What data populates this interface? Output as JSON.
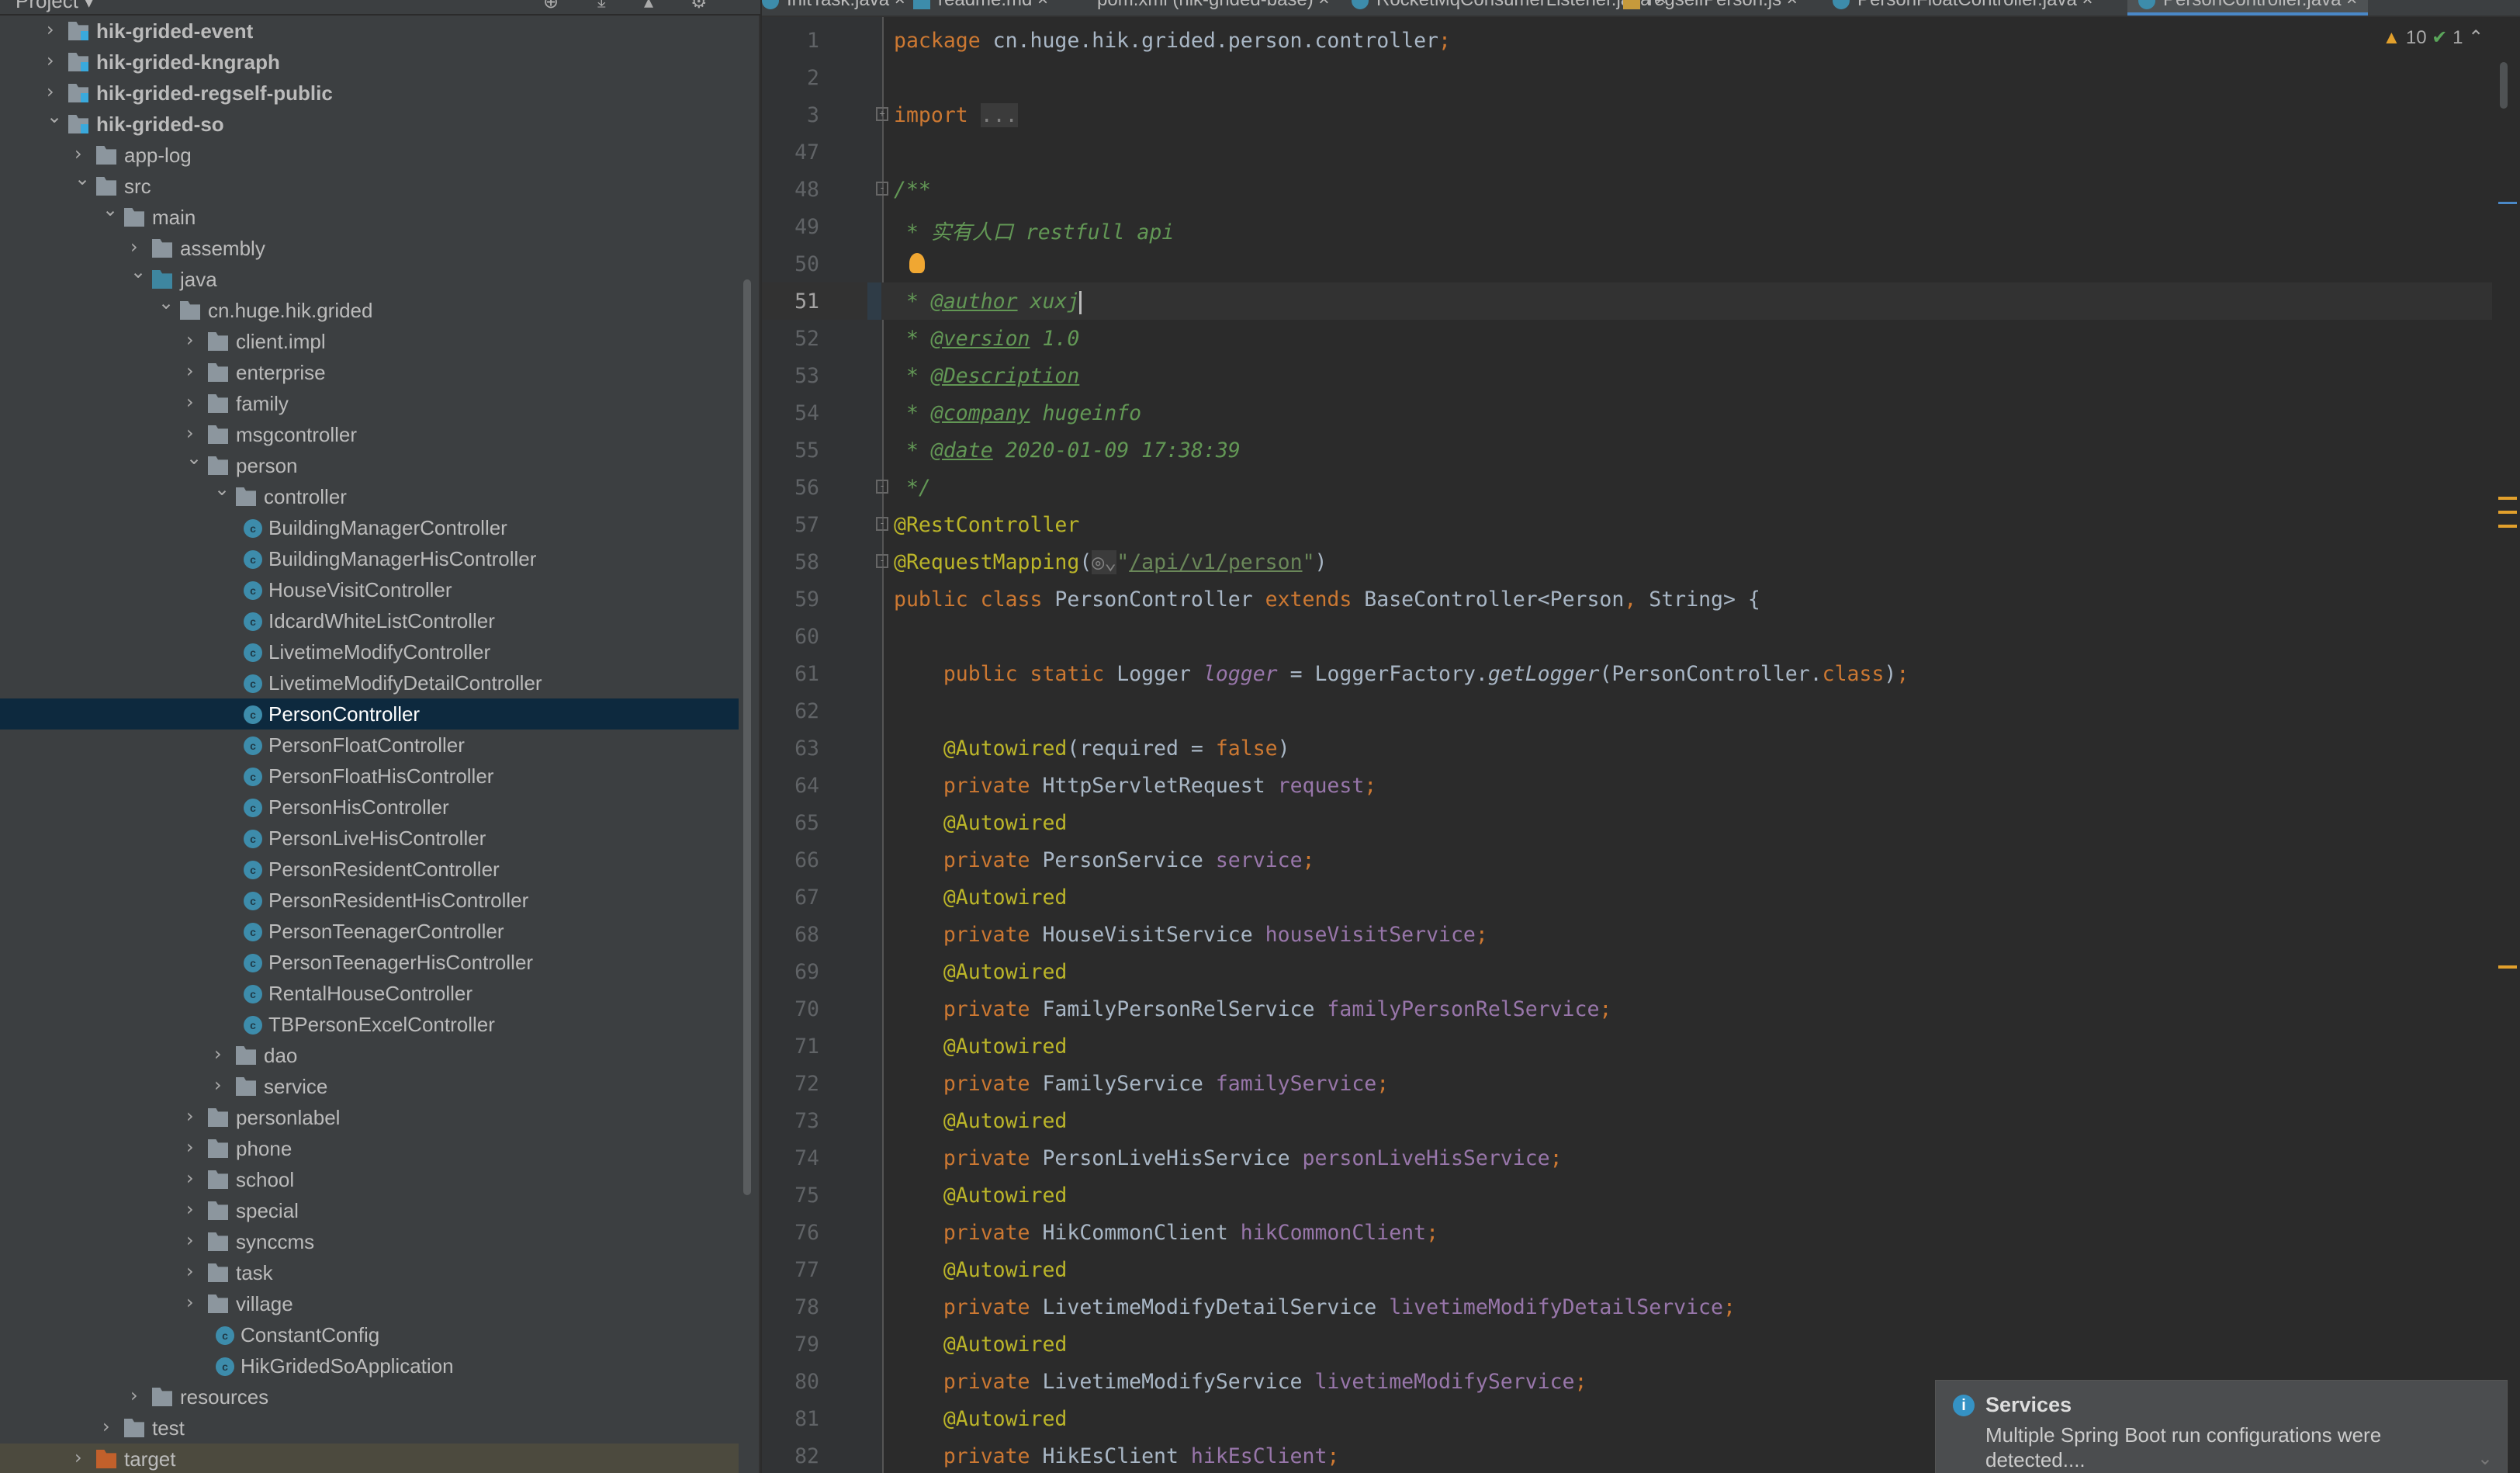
{
  "project_panel": {
    "title": "Project ▾",
    "icons": [
      "target-icon",
      "collapse-icon",
      "expand-icon",
      "gear-icon"
    ]
  },
  "tree": [
    {
      "label": "hik-grided-event",
      "depth": 0,
      "arrow": "right",
      "type": "module",
      "bold": true
    },
    {
      "label": "hik-grided-kngraph",
      "depth": 0,
      "arrow": "right",
      "type": "module",
      "bold": true
    },
    {
      "label": "hik-grided-regself-public",
      "depth": 0,
      "arrow": "right",
      "type": "module",
      "bold": true
    },
    {
      "label": "hik-grided-so",
      "depth": 0,
      "arrow": "down",
      "type": "module",
      "bold": true
    },
    {
      "label": "app-log",
      "depth": 1,
      "arrow": "right",
      "type": "folder"
    },
    {
      "label": "src",
      "depth": 1,
      "arrow": "down",
      "type": "folder"
    },
    {
      "label": "main",
      "depth": 2,
      "arrow": "down",
      "type": "folder"
    },
    {
      "label": "assembly",
      "depth": 3,
      "arrow": "right",
      "type": "folder"
    },
    {
      "label": "java",
      "depth": 3,
      "arrow": "down",
      "type": "source"
    },
    {
      "label": "cn.huge.hik.grided",
      "depth": 4,
      "arrow": "down",
      "type": "package"
    },
    {
      "label": "client.impl",
      "depth": 5,
      "arrow": "right",
      "type": "package"
    },
    {
      "label": "enterprise",
      "depth": 5,
      "arrow": "right",
      "type": "package"
    },
    {
      "label": "family",
      "depth": 5,
      "arrow": "right",
      "type": "package"
    },
    {
      "label": "msgcontroller",
      "depth": 5,
      "arrow": "right",
      "type": "package"
    },
    {
      "label": "person",
      "depth": 5,
      "arrow": "down",
      "type": "package"
    },
    {
      "label": "controller",
      "depth": 6,
      "arrow": "down",
      "type": "package"
    },
    {
      "label": "BuildingManagerController",
      "depth": 7,
      "type": "class"
    },
    {
      "label": "BuildingManagerHisController",
      "depth": 7,
      "type": "class"
    },
    {
      "label": "HouseVisitController",
      "depth": 7,
      "type": "class"
    },
    {
      "label": "IdcardWhiteListController",
      "depth": 7,
      "type": "class"
    },
    {
      "label": "LivetimeModifyController",
      "depth": 7,
      "type": "class"
    },
    {
      "label": "LivetimeModifyDetailController",
      "depth": 7,
      "type": "class"
    },
    {
      "label": "PersonController",
      "depth": 7,
      "type": "class",
      "selected": true
    },
    {
      "label": "PersonFloatController",
      "depth": 7,
      "type": "class"
    },
    {
      "label": "PersonFloatHisController",
      "depth": 7,
      "type": "class"
    },
    {
      "label": "PersonHisController",
      "depth": 7,
      "type": "class"
    },
    {
      "label": "PersonLiveHisController",
      "depth": 7,
      "type": "class"
    },
    {
      "label": "PersonResidentController",
      "depth": 7,
      "type": "class"
    },
    {
      "label": "PersonResidentHisController",
      "depth": 7,
      "type": "class"
    },
    {
      "label": "PersonTeenagerController",
      "depth": 7,
      "type": "class"
    },
    {
      "label": "PersonTeenagerHisController",
      "depth": 7,
      "type": "class"
    },
    {
      "label": "RentalHouseController",
      "depth": 7,
      "type": "class"
    },
    {
      "label": "TBPersonExcelController",
      "depth": 7,
      "type": "class"
    },
    {
      "label": "dao",
      "depth": 6,
      "arrow": "right",
      "type": "package"
    },
    {
      "label": "service",
      "depth": 6,
      "arrow": "right",
      "type": "package"
    },
    {
      "label": "personlabel",
      "depth": 5,
      "arrow": "right",
      "type": "package"
    },
    {
      "label": "phone",
      "depth": 5,
      "arrow": "right",
      "type": "package"
    },
    {
      "label": "school",
      "depth": 5,
      "arrow": "right",
      "type": "package"
    },
    {
      "label": "special",
      "depth": 5,
      "arrow": "right",
      "type": "package"
    },
    {
      "label": "synccms",
      "depth": 5,
      "arrow": "right",
      "type": "package"
    },
    {
      "label": "task",
      "depth": 5,
      "arrow": "right",
      "type": "package"
    },
    {
      "label": "village",
      "depth": 5,
      "arrow": "right",
      "type": "package"
    },
    {
      "label": "ConstantConfig",
      "depth": 6,
      "type": "class"
    },
    {
      "label": "HikGridedSoApplication",
      "depth": 6,
      "type": "app"
    },
    {
      "label": "resources",
      "depth": 3,
      "arrow": "right",
      "type": "resources"
    },
    {
      "label": "test",
      "depth": 2,
      "arrow": "right",
      "type": "folder"
    },
    {
      "label": "target",
      "depth": 1,
      "arrow": "right",
      "type": "target",
      "excluded": true
    }
  ],
  "tabs": [
    {
      "label": "InitTask.java ×",
      "icon": "java-class-icon"
    },
    {
      "label": "readme.md ×",
      "icon": "markdown-icon"
    },
    {
      "label": "pom.xml (hik-grided-base) ×",
      "icon": "maven-icon"
    },
    {
      "label": "RocketMqConsumerListener.java ×",
      "icon": "java-class-icon"
    },
    {
      "label": "regselfPerson.js ×",
      "icon": "javascript-icon"
    },
    {
      "label": "PersonFloatController.java ×",
      "icon": "java-class-icon"
    },
    {
      "label": "PersonController.java ×",
      "icon": "java-class-icon",
      "active": true
    }
  ],
  "inspection": {
    "warnings": "10",
    "weak_warnings": "1"
  },
  "editor": {
    "current_line": "51",
    "lines": [
      {
        "n": "1",
        "t": [
          [
            "kw",
            "package "
          ],
          [
            "",
            "cn.huge.hik.grided.person.controller"
          ],
          [
            "kw",
            ";"
          ]
        ]
      },
      {
        "n": "2",
        "t": []
      },
      {
        "n": "3",
        "fold": "+",
        "t": [
          [
            "kw",
            "import "
          ],
          [
            "gr",
            "..."
          ]
        ]
      },
      {
        "n": "47",
        "t": []
      },
      {
        "n": "48",
        "fold": "-",
        "t": [
          [
            "dc",
            "/**"
          ]
        ]
      },
      {
        "n": "49",
        "t": [
          [
            "dc",
            " * 实有人口 restfull api"
          ]
        ]
      },
      {
        "n": "50",
        "bulb": true,
        "t": []
      },
      {
        "n": "51",
        "t": [
          [
            "dc",
            " * "
          ],
          [
            "tg",
            "@author"
          ],
          [
            "dc",
            " xuxj"
          ],
          [
            "caret",
            ""
          ]
        ]
      },
      {
        "n": "52",
        "t": [
          [
            "dc",
            " * "
          ],
          [
            "tg",
            "@version"
          ],
          [
            "dc",
            " 1.0"
          ]
        ]
      },
      {
        "n": "53",
        "t": [
          [
            "dc",
            " * "
          ],
          [
            "tg",
            "@Description"
          ]
        ]
      },
      {
        "n": "54",
        "t": [
          [
            "dc",
            " * "
          ],
          [
            "tg",
            "@company"
          ],
          [
            "dc",
            " hugeinfo"
          ]
        ]
      },
      {
        "n": "55",
        "t": [
          [
            "dc",
            " * "
          ],
          [
            "tg",
            "@date"
          ],
          [
            "dc",
            " 2020-01-09 17:38:39"
          ]
        ]
      },
      {
        "n": "56",
        "fold": "-",
        "t": [
          [
            "dc",
            " */"
          ]
        ]
      },
      {
        "n": "57",
        "fold": "-",
        "t": [
          [
            "an",
            "@RestController"
          ]
        ]
      },
      {
        "n": "58",
        "fold": "-",
        "t": [
          [
            "an",
            "@RequestMapping"
          ],
          [
            "",
            "("
          ],
          [
            "gr",
            "◎⌄"
          ],
          [
            "st",
            "\""
          ],
          [
            "st ul",
            "/api/v1/person"
          ],
          [
            "st",
            "\""
          ],
          [
            "",
            ")"
          ]
        ]
      },
      {
        "n": "59",
        "t": [
          [
            "kw",
            "public class "
          ],
          [
            "",
            "PersonController "
          ],
          [
            "kw",
            "extends "
          ],
          [
            "",
            "BaseController<Person"
          ],
          [
            "kw",
            ","
          ],
          [
            "",
            " String> {"
          ]
        ]
      },
      {
        "n": "60",
        "t": []
      },
      {
        "n": "61",
        "t": [
          [
            "",
            "    "
          ],
          [
            "kw",
            "public static "
          ],
          [
            "",
            "Logger "
          ],
          [
            "fd it",
            "logger"
          ],
          [
            "",
            " = LoggerFactory."
          ],
          [
            "it",
            "getLogger"
          ],
          [
            "",
            "(PersonController."
          ],
          [
            "kw",
            "class"
          ],
          [
            "",
            ")"
          ],
          [
            "kw",
            ";"
          ]
        ]
      },
      {
        "n": "62",
        "t": []
      },
      {
        "n": "63",
        "t": [
          [
            "",
            "    "
          ],
          [
            "an",
            "@Autowired"
          ],
          [
            "",
            "(required = "
          ],
          [
            "kw",
            "false"
          ],
          [
            "",
            ")"
          ]
        ]
      },
      {
        "n": "64",
        "t": [
          [
            "",
            "    "
          ],
          [
            "kw",
            "private "
          ],
          [
            "",
            "HttpServletRequest "
          ],
          [
            "fd",
            "request"
          ],
          [
            "kw",
            ";"
          ]
        ]
      },
      {
        "n": "65",
        "t": [
          [
            "",
            "    "
          ],
          [
            "an",
            "@Autowired"
          ]
        ]
      },
      {
        "n": "66",
        "t": [
          [
            "",
            "    "
          ],
          [
            "kw",
            "private "
          ],
          [
            "",
            "PersonService "
          ],
          [
            "fd",
            "service"
          ],
          [
            "kw",
            ";"
          ]
        ]
      },
      {
        "n": "67",
        "t": [
          [
            "",
            "    "
          ],
          [
            "an",
            "@Autowired"
          ]
        ]
      },
      {
        "n": "68",
        "t": [
          [
            "",
            "    "
          ],
          [
            "kw",
            "private "
          ],
          [
            "",
            "HouseVisitService "
          ],
          [
            "fd",
            "houseVisitService"
          ],
          [
            "kw",
            ";"
          ]
        ]
      },
      {
        "n": "69",
        "t": [
          [
            "",
            "    "
          ],
          [
            "an",
            "@Autowired"
          ]
        ]
      },
      {
        "n": "70",
        "t": [
          [
            "",
            "    "
          ],
          [
            "kw",
            "private "
          ],
          [
            "",
            "FamilyPersonRelService "
          ],
          [
            "fd",
            "familyPersonRelService"
          ],
          [
            "kw",
            ";"
          ]
        ]
      },
      {
        "n": "71",
        "t": [
          [
            "",
            "    "
          ],
          [
            "an",
            "@Autowired"
          ]
        ]
      },
      {
        "n": "72",
        "t": [
          [
            "",
            "    "
          ],
          [
            "kw",
            "private "
          ],
          [
            "",
            "FamilyService "
          ],
          [
            "fd",
            "familyService"
          ],
          [
            "kw",
            ";"
          ]
        ]
      },
      {
        "n": "73",
        "t": [
          [
            "",
            "    "
          ],
          [
            "an",
            "@Autowired"
          ]
        ]
      },
      {
        "n": "74",
        "t": [
          [
            "",
            "    "
          ],
          [
            "kw",
            "private "
          ],
          [
            "",
            "PersonLiveHisService "
          ],
          [
            "fd",
            "personLiveHisService"
          ],
          [
            "kw",
            ";"
          ]
        ]
      },
      {
        "n": "75",
        "t": [
          [
            "",
            "    "
          ],
          [
            "an",
            "@Autowired"
          ]
        ]
      },
      {
        "n": "76",
        "t": [
          [
            "",
            "    "
          ],
          [
            "kw",
            "private "
          ],
          [
            "",
            "HikCommonClient "
          ],
          [
            "fd",
            "hikCommonClient"
          ],
          [
            "kw",
            ";"
          ]
        ]
      },
      {
        "n": "77",
        "t": [
          [
            "",
            "    "
          ],
          [
            "an",
            "@Autowired"
          ]
        ]
      },
      {
        "n": "78",
        "t": [
          [
            "",
            "    "
          ],
          [
            "kw",
            "private "
          ],
          [
            "",
            "LivetimeModifyDetailService "
          ],
          [
            "fd",
            "livetimeModifyDetailService"
          ],
          [
            "kw",
            ";"
          ]
        ]
      },
      {
        "n": "79",
        "t": [
          [
            "",
            "    "
          ],
          [
            "an",
            "@Autowired"
          ]
        ]
      },
      {
        "n": "80",
        "t": [
          [
            "",
            "    "
          ],
          [
            "kw",
            "private "
          ],
          [
            "",
            "LivetimeModifyService "
          ],
          [
            "fd",
            "livetimeModifyService"
          ],
          [
            "kw",
            ";"
          ]
        ]
      },
      {
        "n": "81",
        "t": [
          [
            "",
            "    "
          ],
          [
            "an",
            "@Autowired"
          ]
        ]
      },
      {
        "n": "82",
        "t": [
          [
            "",
            "    "
          ],
          [
            "kw",
            "private "
          ],
          [
            "",
            "HikEsClient "
          ],
          [
            "fd",
            "hikEsClient"
          ],
          [
            "kw",
            ";"
          ]
        ]
      }
    ]
  },
  "notification": {
    "title": "Services",
    "message": "Multiple Spring Boot run configurations were detected...."
  },
  "colors": {
    "keyword": "#cc7832",
    "annotation": "#bbb529",
    "string": "#6a8759",
    "field": "#9876aa",
    "doc_comment": "#629755",
    "text": "#a9b7c6",
    "selection": "#0d293e",
    "accent": "#4a88c7"
  }
}
